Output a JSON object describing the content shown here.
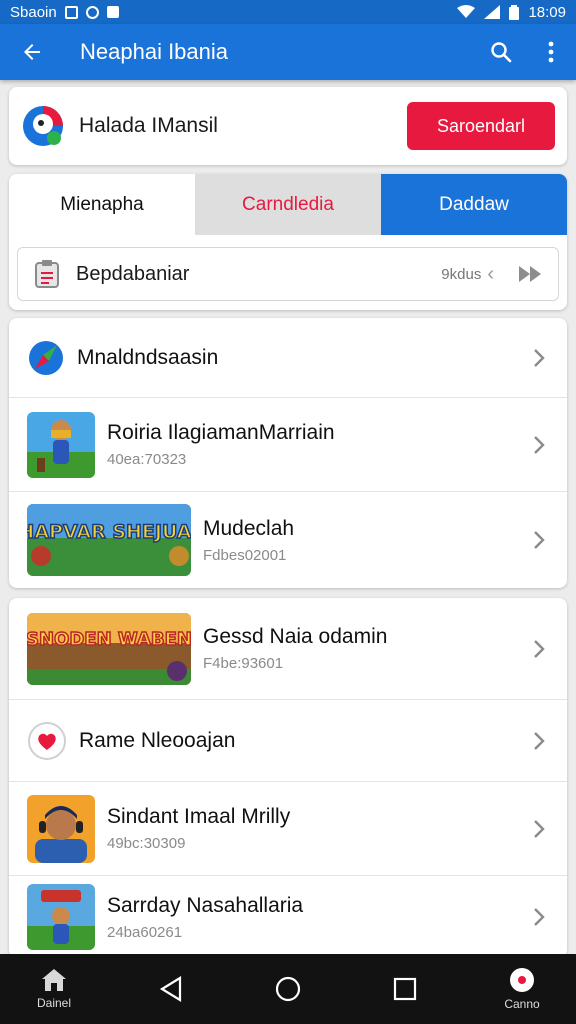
{
  "status_bar": {
    "left_text": "Sbaoin",
    "time": "18:09"
  },
  "app_bar": {
    "title": "Neaphai Ibania",
    "icons": [
      "arrow-left-icon",
      "search-icon",
      "more-vert-icon"
    ]
  },
  "profile": {
    "name": "Halada IMansil",
    "button_label": "Saroendarl"
  },
  "tabs": [
    {
      "label": "Mienapha"
    },
    {
      "label": "Carndledia"
    },
    {
      "label": "Daddaw"
    }
  ],
  "filter": {
    "label": "Bepdabaniar",
    "sort_label": "9kdus"
  },
  "list_section_1": [
    {
      "title": "Mnaldndsaasin",
      "subtitle": "",
      "icon": "compass-icon"
    },
    {
      "title": "Roiria IlagiamanMarriain",
      "subtitle": "40ea:70323",
      "icon": "game-thumbnail"
    },
    {
      "title": "Mudeclah",
      "subtitle": "Fdbes02001",
      "icon": "game-thumbnail",
      "thumb_text": "SHAPVAR SHEJUAIA"
    }
  ],
  "list_section_2": [
    {
      "title": "Gessd Naia odamin",
      "subtitle": "F4be:93601",
      "icon": "game-thumbnail",
      "thumb_text": "SNODEN WABEN"
    },
    {
      "title": "Rame Nleooajan",
      "subtitle": "",
      "icon": "heart-icon"
    },
    {
      "title": "Sindant Imaal Mrilly",
      "subtitle": "49bc:30309",
      "icon": "avatar-thumbnail"
    },
    {
      "title": "Sarrday Nasahallaria",
      "subtitle": "24ba60261",
      "icon": "game-thumbnail"
    }
  ],
  "bottom_nav": {
    "home_label": "Dainel",
    "profile_label": "Canno"
  },
  "colors": {
    "primary": "#1a73d9",
    "accent": "#e8193f",
    "status_bar": "#1669c5",
    "nav_bar": "#121212"
  }
}
